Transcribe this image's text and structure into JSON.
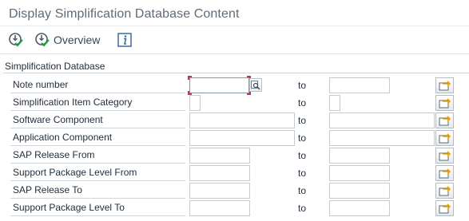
{
  "window": {
    "title": "Display Simplification Database Content"
  },
  "toolbar": {
    "overview_label": "Overview"
  },
  "group": {
    "title": "Simplification Database"
  },
  "rows": [
    {
      "label": "Note number",
      "to": "to",
      "from_value": "",
      "to_value": ""
    },
    {
      "label": "Simplification Item Category",
      "to": "to",
      "from_value": "",
      "to_value": ""
    },
    {
      "label": "Software Component",
      "to": "to",
      "from_value": "",
      "to_value": ""
    },
    {
      "label": "Application Component",
      "to": "to",
      "from_value": "",
      "to_value": ""
    },
    {
      "label": "SAP Release From",
      "to": "to",
      "from_value": "",
      "to_value": ""
    },
    {
      "label": "Support Package Level From",
      "to": "to",
      "from_value": "",
      "to_value": ""
    },
    {
      "label": "SAP Release To",
      "to": "to",
      "from_value": "",
      "to_value": ""
    },
    {
      "label": "Support Package Level To",
      "to": "to",
      "from_value": "",
      "to_value": ""
    }
  ],
  "colors": {
    "accent": "#1a7f3c",
    "focus_corner": "#c0354c",
    "arrow": "#f0a000"
  }
}
